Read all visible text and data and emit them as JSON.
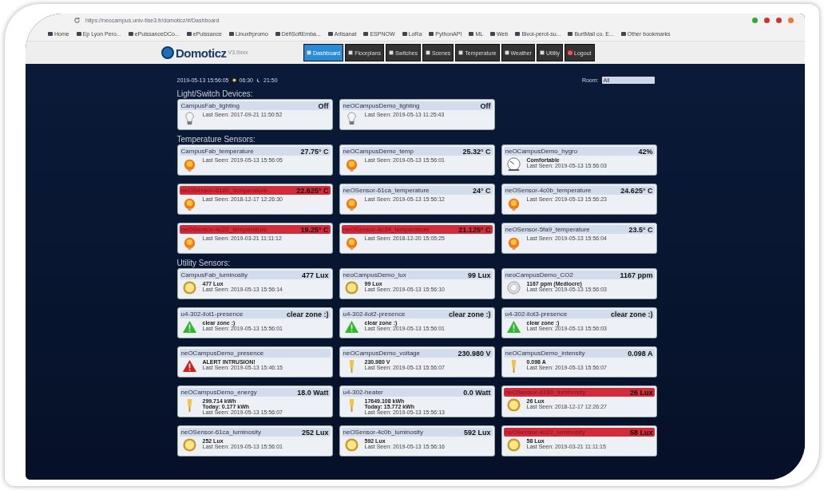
{
  "browser": {
    "url": "https://neocampus.univ-tlse3.fr/domoticz/#/Dashboard",
    "bookmarks": [
      "Home",
      "Ep Lyon Pero...",
      "ePuissanceDCo...",
      "ePuissance",
      "Linuxfrpromo",
      "DéfiSoftEmba...",
      "Artisanat",
      "ESPNOW",
      "LoRa",
      "PythonAPI",
      "ML",
      "Web",
      "Bivol-perot-su...",
      "BurtMail co. E...",
      "Other bookmarks"
    ]
  },
  "app": {
    "logo": "Domoticz",
    "version": "V3.9xxx",
    "tabs": [
      {
        "label": "Dashboard",
        "selected": true
      },
      {
        "label": "Floorplans",
        "selected": false
      },
      {
        "label": "Switches",
        "selected": false
      },
      {
        "label": "Scenes",
        "selected": false
      },
      {
        "label": "Temperature",
        "selected": false
      },
      {
        "label": "Weather",
        "selected": false
      },
      {
        "label": "Utility",
        "selected": false
      },
      {
        "label": "Logout",
        "kind": "logout",
        "selected": false
      }
    ]
  },
  "status": {
    "datetime": "2019-05-13 15:56:05",
    "sunrise": "06:30",
    "sunset": "21:50",
    "room_label": "Room:",
    "room_value": "All"
  },
  "sections": [
    {
      "title": "Light/Switch Devices:",
      "devices": [
        {
          "name": "CampusFab_lighting",
          "value": "Off",
          "alert": false,
          "kind": "bulb",
          "lines": [
            "Last Seen: 2017-09-21 11:50:52"
          ]
        },
        {
          "name": "neOCampusDemo_lighting",
          "value": "Off",
          "alert": false,
          "kind": "bulb",
          "lines": [
            "Last Seen: 2019-05-13 11:25:43"
          ]
        }
      ]
    },
    {
      "title": "Temperature Sensors:",
      "devices": [
        {
          "name": "CampusFab_temperature",
          "value": "27.75° C",
          "alert": false,
          "kind": "temp",
          "lines": [
            "Last Seen: 2019-05-13 15:56:05"
          ]
        },
        {
          "name": "neOCampusDemo_temp",
          "value": "25.32° C",
          "alert": false,
          "kind": "temp",
          "lines": [
            "Last Seen: 2019-05-13 15:56:01"
          ]
        },
        {
          "name": "neOCampusDemo_hygro",
          "value": "42%",
          "alert": false,
          "kind": "hygro",
          "lines": [
            "Comfortable",
            "Last Seen: 2019-05-13 15:56:03"
          ]
        },
        {
          "name": "neOSensor-6180_temperature",
          "value": "22.625° C",
          "alert": true,
          "kind": "temp",
          "lines": [
            "Last Seen: 2018-12-17 12:26:30"
          ]
        },
        {
          "name": "neOSensor-61ca_temperature",
          "value": "24° C",
          "alert": false,
          "kind": "temp",
          "lines": [
            "Last Seen: 2019-05-13 15:56:12"
          ]
        },
        {
          "name": "neOSensor-4c0b_temperature",
          "value": "24.625° C",
          "alert": false,
          "kind": "temp",
          "lines": [
            "Last Seen: 2019-05-13 15:56:23"
          ]
        },
        {
          "name": "neOSensor-4c22_temperature",
          "value": "19.25° C",
          "alert": true,
          "kind": "temp",
          "lines": [
            "Last Seen: 2019-03-21 11:11:12"
          ]
        },
        {
          "name": "neOSensor-4c34_temperature",
          "value": "21.125° C",
          "alert": true,
          "kind": "temp",
          "lines": [
            "Last Seen: 2018-12-20 15:05:25"
          ]
        },
        {
          "name": "neOSensor-5fa9_temperature",
          "value": "23.5° C",
          "alert": false,
          "kind": "temp",
          "lines": [
            "Last Seen: 2019-05-13 15:56:04"
          ]
        }
      ]
    },
    {
      "title": "Utility Sensors:",
      "devices": [
        {
          "name": "CampusFab_luminosity",
          "value": "477 Lux",
          "alert": false,
          "kind": "lux",
          "lines": [
            "477 Lux",
            "Last Seen: 2019-05-13 15:56:14"
          ]
        },
        {
          "name": "neoCampusDemo_lux",
          "value": "99 Lux",
          "alert": false,
          "kind": "lux",
          "lines": [
            "99 Lux",
            "Last Seen: 2019-05-13 15:56:10"
          ]
        },
        {
          "name": "neoCampusDemo_CO2",
          "value": "1167 ppm",
          "alert": false,
          "kind": "co2",
          "lines": [
            "1167 ppm (Mediocre)",
            "Last Seen: 2019-05-13 15:56:03"
          ]
        },
        {
          "name": "u4-302-ilot1-presence",
          "value": "clear zone :)",
          "alert": false,
          "kind": "ok",
          "lines": [
            "clear zone :)",
            "Last Seen: 2019-05-13 15:56:01"
          ]
        },
        {
          "name": "u4-302-ilot2-presence",
          "value": "clear zone :)",
          "alert": false,
          "kind": "ok",
          "lines": [
            "clear zone :)",
            "Last Seen: 2019-05-13 15:56:01"
          ]
        },
        {
          "name": "u4-302-ilot3-presence",
          "value": "clear zone :)",
          "alert": false,
          "kind": "ok",
          "lines": [
            "clear zone :)",
            "Last Seen: 2019-05-13 15:56:03"
          ]
        },
        {
          "name": "neOCampusDemo_presence",
          "alert": false,
          "kind": "warn",
          "lines": [
            "ALERT INTRUSION!",
            "Last Seen: 2019-05-13 15:46:15"
          ]
        },
        {
          "name": "neOCampusDemo_voltage",
          "value": "230.980 V",
          "alert": false,
          "kind": "power",
          "lines": [
            "230.980 V",
            "Last Seen: 2019-05-13 15:56:07"
          ]
        },
        {
          "name": "neOCampusDemo_intensity",
          "value": "0.098 A",
          "alert": false,
          "kind": "power",
          "lines": [
            "0.098 A",
            "Last Seen: 2019-05-13 15:56:07"
          ]
        },
        {
          "name": "neOCampusDemo_energy",
          "value": "18.0 Watt",
          "alert": false,
          "kind": "power",
          "lines": [
            "299.714 kWh",
            "Today: 0.177 kWh",
            "Last Seen: 2019-05-13 15:56:07"
          ]
        },
        {
          "name": "u4-302-heater",
          "value": "0.0 Watt",
          "alert": false,
          "kind": "power",
          "lines": [
            "17649.108 kWh",
            "Today: 15.772 kWh",
            "Last Seen: 2019-05-13 15:56:13"
          ]
        },
        {
          "name": "neOSensor-6180_luminosity",
          "value": "26 Lux",
          "alert": true,
          "kind": "lux",
          "lines": [
            "26 Lux",
            "Last Seen: 2018-12-17 12:26:27"
          ]
        },
        {
          "name": "neOSensor-61ca_luminosity",
          "value": "252 Lux",
          "alert": false,
          "kind": "lux",
          "lines": [
            "252 Lux",
            "Last Seen: 2019-05-13 15:56:01"
          ]
        },
        {
          "name": "neOSensor-4c0b_luminosity",
          "value": "592 Lux",
          "alert": false,
          "kind": "lux",
          "lines": [
            "592 Lux",
            "Last Seen: 2019-05-13 15:56:16"
          ]
        },
        {
          "name": "neOSensor-4c22_luminosity",
          "value": "58 Lux",
          "alert": true,
          "kind": "lux",
          "lines": [
            "58 Lux",
            "Last Seen: 2019-03-21 11:11:15"
          ]
        }
      ]
    }
  ]
}
